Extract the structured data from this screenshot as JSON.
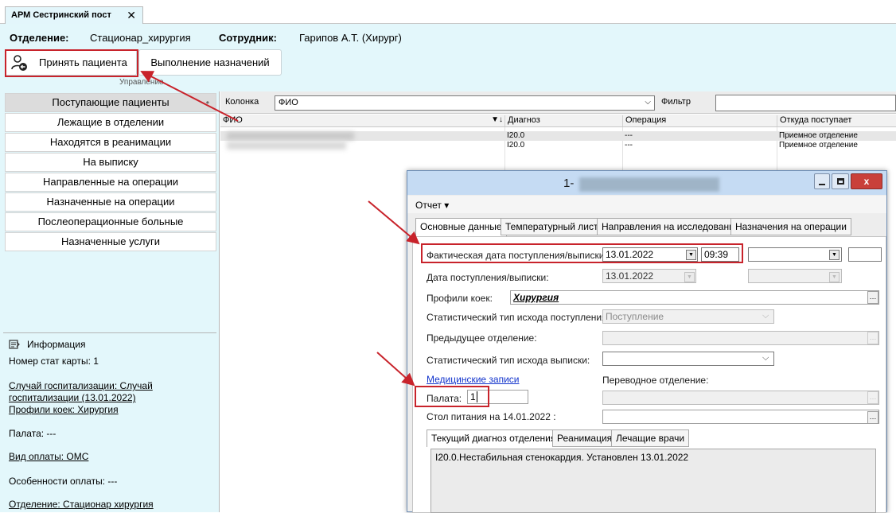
{
  "tab": {
    "title": "АРМ Сестринский пост",
    "close": "✕"
  },
  "header": {
    "dept_label": "Отделение:",
    "dept_value": "Стационар_хирургия",
    "emp_label": "Сотрудник:",
    "emp_value": "Гарипов А.Т. (Хирург)"
  },
  "ribbon": {
    "accept_btn": "Принять пациента",
    "assignments_btn": "Выполнение назначений",
    "group": "Управление"
  },
  "nav": {
    "items": [
      "Поступающие пациенты",
      "Лежащие в отделении",
      "Находятся в реанимации",
      "На выписку",
      "Направленные на операции",
      "Назначенные на операции",
      "Послеоперационные больные",
      "Назначенные услуги"
    ],
    "active_dot": "•"
  },
  "info": {
    "title": "Информация",
    "card_number": "Номер стат карты: 1",
    "hosp_case": "Случай госпитализации: Случай госпитализации (13.01.2022)",
    "bed_profiles": "Профили коек: Хирургия",
    "ward": "Палата: ---",
    "payment": "Вид оплаты: ОМС",
    "payment_features": "Особенности оплаты: ---",
    "department": "Отделение: Стационар хирургия"
  },
  "filter": {
    "column_label": "Колонка",
    "column_value": "ФИО",
    "filter_label": "Фильтр"
  },
  "grid": {
    "columns": [
      "ФИО",
      "Диагноз",
      "Операция",
      "Откуда поступает"
    ],
    "rows": [
      {
        "diagnosis": "I20.0",
        "operation": "---",
        "source": "Приемное отделение"
      },
      {
        "diagnosis": "I20.0",
        "operation": "---",
        "source": "Приемное отделение"
      }
    ]
  },
  "dialog": {
    "title_prefix": "1-",
    "menu": {
      "report": "Отчет ▾"
    },
    "tabs": [
      "Основные данные",
      "Температурный лист",
      "Направления на исследования",
      "Назначения на операции"
    ],
    "fields": {
      "actual_date_label": "Фактическая дата поступления/выписки:",
      "actual_date_value": "13.01.2022",
      "actual_time_value": "09:39",
      "admission_date_label": "Дата поступления/выписки:",
      "admission_date_value": "13.01.2022",
      "bed_profiles_label": "Профили коек:",
      "bed_profiles_value": "Хирургия",
      "admission_outcome_label": "Статистический тип исхода поступления:",
      "admission_outcome_value": "Поступление",
      "prev_dept_label": "Предыдущее отделение:",
      "discharge_outcome_label": "Статистический тип исхода выписки:",
      "medical_records_link": "Медицинские записи",
      "transfer_dept_label": "Переводное отделение:",
      "ward_label": "Палата:",
      "ward_value": "1",
      "meal_table_label": "Стол питания на 14.01.2022 :"
    },
    "subtabs": [
      "Текущий диагноз отделения",
      "Реанимация",
      "Лечащие врачи"
    ],
    "diagnosis_text": "I20.0.Нестабильная стенокардия. Установлен 13.01.2022"
  },
  "annotation_color": "#c8232b"
}
